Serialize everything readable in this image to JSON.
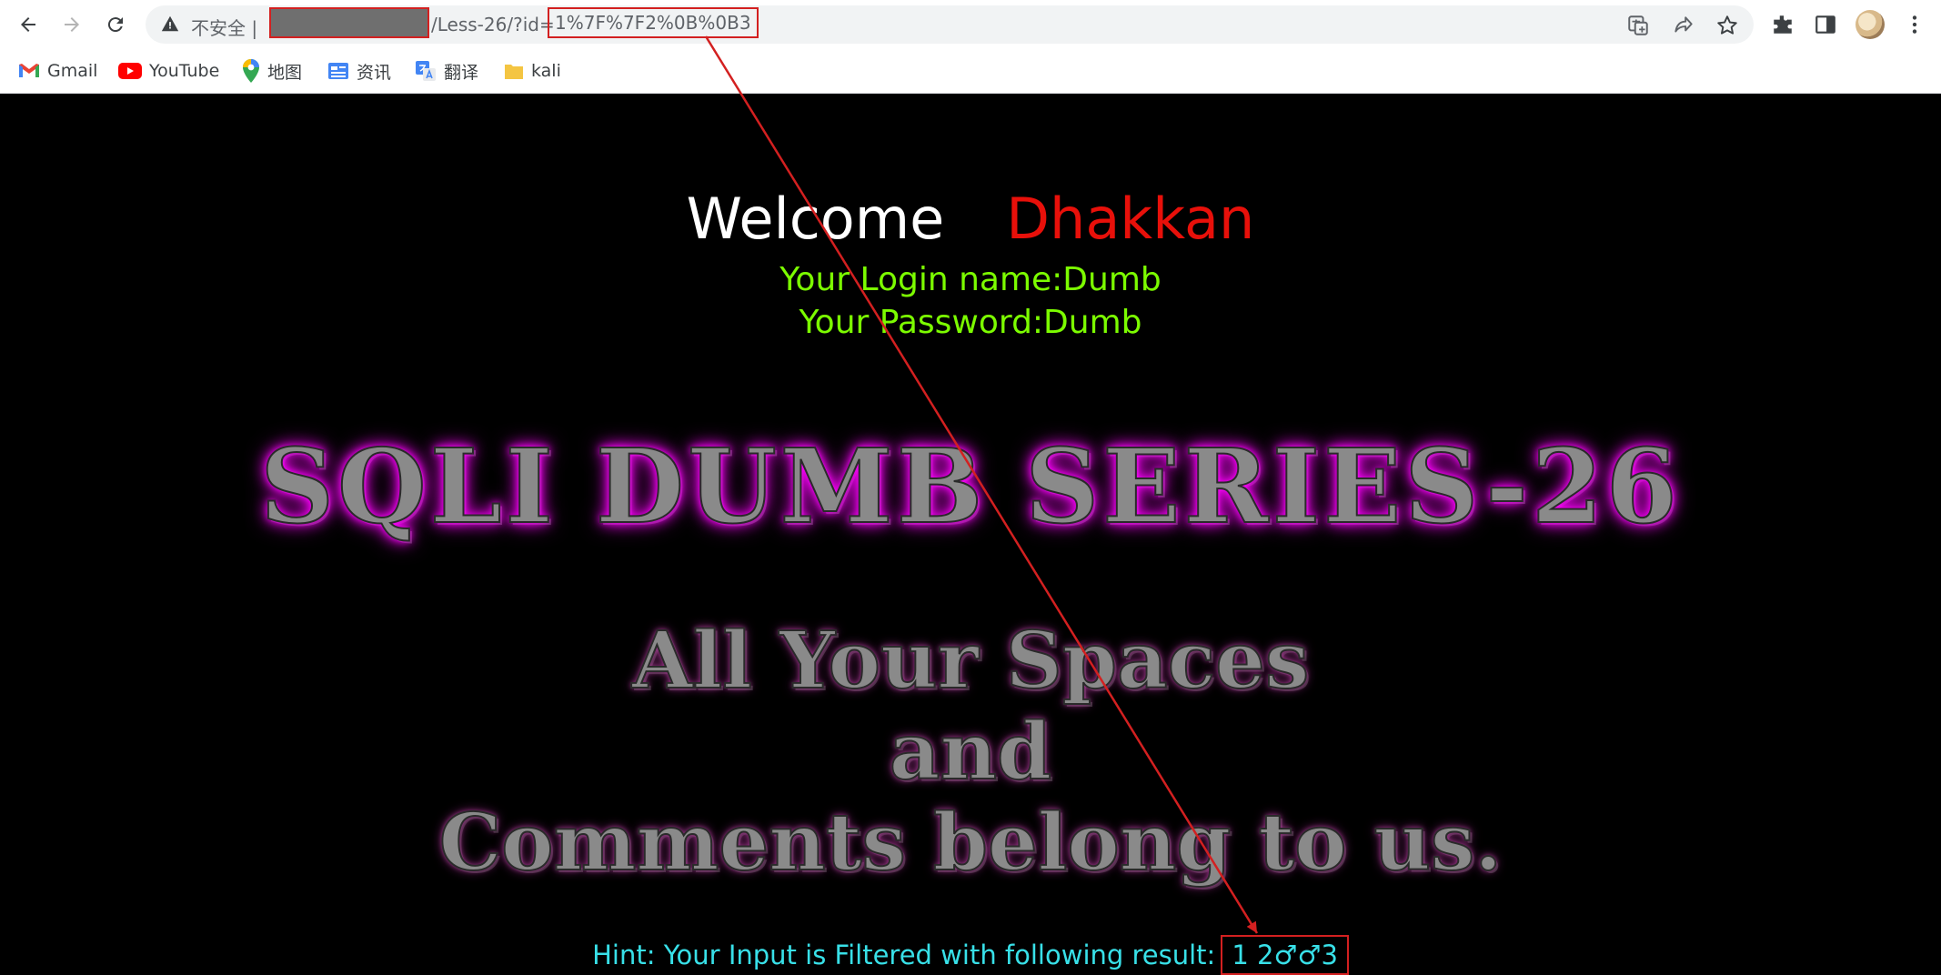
{
  "browser": {
    "security_label": "不安全 |",
    "url_path": "/Less-26/?id=",
    "url_query": "1%7F%7F2%0B%0B3"
  },
  "bookmarks": [
    {
      "label": "Gmail",
      "icon": "gmail-icon"
    },
    {
      "label": "YouTube",
      "icon": "youtube-icon"
    },
    {
      "label": "地图",
      "icon": "maps-icon"
    },
    {
      "label": "资讯",
      "icon": "news-icon"
    },
    {
      "label": "翻译",
      "icon": "translate-icon"
    },
    {
      "label": "kali",
      "icon": "folder-icon"
    }
  ],
  "page": {
    "welcome": "Welcome",
    "username_display": "Dhakkan",
    "login_name": "Your Login name:Dumb",
    "password": "Your Password:Dumb",
    "title": "SQLI DUMB SERIES-26",
    "subtitle_lines": [
      "All Your Spaces",
      "and",
      "Comments belong to us."
    ],
    "hint_prefix": "Hint: Your Input is Filtered with following result:",
    "hint_result": "1  2♂♂3"
  },
  "colors": {
    "background": "#000000",
    "welcome": "#ffffff",
    "username": "#e8100a",
    "login_text": "#7cfc00",
    "hint_text": "#38e0e8",
    "banner_glow": "#ff00ff",
    "annotation": "#d32020"
  }
}
